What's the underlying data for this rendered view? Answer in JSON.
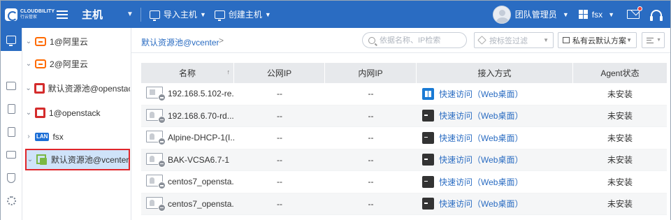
{
  "brand": {
    "name": "CLOUDBILITY",
    "sub": "行云管家"
  },
  "header": {
    "module": "主机",
    "import_label": "导入主机",
    "create_label": "创建主机",
    "user": "团队管理员",
    "tenant": "fsx"
  },
  "rail": [
    "monitor-icon",
    "topology-icon",
    "folder-icon",
    "clipboard-icon",
    "report-icon",
    "activity-icon",
    "shield-icon",
    "settings-icon"
  ],
  "tree": {
    "items": [
      {
        "label": "1@阿里云",
        "type": "aliyun"
      },
      {
        "label": "2@阿里云",
        "type": "aliyun"
      },
      {
        "label": "默认资源池@openstack",
        "type": "openstack"
      },
      {
        "label": "1@openstack",
        "type": "openstack"
      },
      {
        "label": "fsx",
        "type": "lan",
        "badge": "LAN"
      },
      {
        "label": "默认资源池@vcenter",
        "type": "vcenter",
        "selected": true
      }
    ]
  },
  "breadcrumb": {
    "current": "默认资源池@vcenter",
    "sep": ">"
  },
  "toolbar": {
    "search_placeholder": "依据名称、IP检索",
    "tag_filter": "按标签过滤",
    "scheme": "私有云默认方案"
  },
  "table": {
    "headers": [
      "名称",
      "公网IP",
      "内网IP",
      "接入方式",
      "Agent状态"
    ],
    "sort_indicator": "↑",
    "rows": [
      {
        "name": "192.168.5.102-re...",
        "public_ip": "--",
        "private_ip": "--",
        "access": "快速访问（Web桌面）",
        "os": "windows",
        "agent": "未安装"
      },
      {
        "name": "192.168.6.70-rd...",
        "public_ip": "--",
        "private_ip": "--",
        "access": "快速访问（Web桌面）",
        "os": "linux",
        "agent": "未安装"
      },
      {
        "name": "Alpine-DHCP-1(I...",
        "public_ip": "--",
        "private_ip": "--",
        "access": "快速访问（Web桌面）",
        "os": "linux",
        "agent": "未安装"
      },
      {
        "name": "BAK-VCSA6.7-1",
        "public_ip": "--",
        "private_ip": "--",
        "access": "快速访问（Web桌面）",
        "os": "linux",
        "agent": "未安装"
      },
      {
        "name": "centos7_opensta...",
        "public_ip": "--",
        "private_ip": "--",
        "access": "快速访问（Web桌面）",
        "os": "linux",
        "agent": "未安装"
      },
      {
        "name": "centos7_opensta...",
        "public_ip": "--",
        "private_ip": "--",
        "access": "快速访问（Web桌面）",
        "os": "linux",
        "agent": "未安装"
      }
    ]
  },
  "colors": {
    "primary": "#2a6cc2",
    "selected_bg": "#cfe3f9",
    "highlight_border": "#e0262b"
  }
}
